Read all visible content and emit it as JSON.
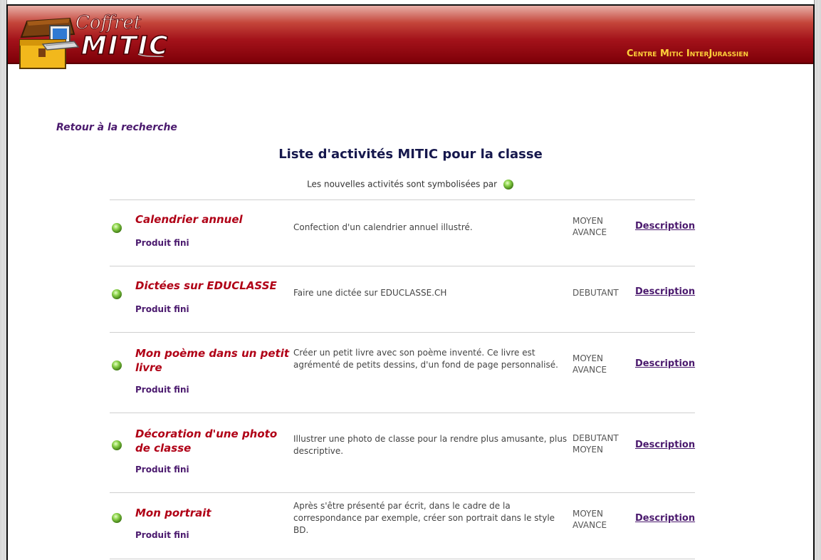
{
  "header": {
    "logo_small": "Coffret",
    "logo_big": "MITIC",
    "center_name": "Centre Mitic InterJurassien"
  },
  "nav": {
    "back_link": "Retour à la recherche"
  },
  "main": {
    "title": "Liste d'activités MITIC pour la classe",
    "legend": "Les nouvelles activités sont symbolisées par",
    "activities": [
      {
        "title": "Calendrier annuel",
        "category": "Produit fini",
        "description": "Confection d'un calendrier annuel illustré.",
        "level": "MOYEN AVANCE",
        "link": "Description",
        "is_new": true
      },
      {
        "title": "Dictées sur EDUCLASSE",
        "category": "Produit fini",
        "description": "Faire une dictée sur EDUCLASSE.CH",
        "level": "DEBUTANT",
        "link": "Description",
        "is_new": true
      },
      {
        "title": "Mon poème dans un petit livre",
        "category": "Produit fini",
        "description": "Créer un petit livre avec son poème inventé. Ce livre est agrémenté de petits dessins, d'un fond de page personnalisé.",
        "level": "MOYEN AVANCE",
        "link": "Description",
        "is_new": true
      },
      {
        "title": "Décoration d'une photo de classe",
        "category": "Produit fini",
        "description": "Illustrer une photo de classe pour la rendre plus amusante, plus descriptive.",
        "level": "DEBUTANT MOYEN",
        "link": "Description",
        "is_new": true
      },
      {
        "title": "Mon portrait",
        "category": "Produit fini",
        "description": "Après s'être présenté par écrit, dans le cadre de la correspondance par exemple, créer son portrait dans le style BD.",
        "level": "MOYEN AVANCE",
        "link": "Description",
        "is_new": true
      }
    ]
  },
  "colors": {
    "header_red": "#a3121a",
    "title_red": "#b00016",
    "link_purple": "#4b1a6e",
    "new_dot_green": "#7cc43a"
  },
  "icons": {
    "new_indicator": "green-dot-icon"
  }
}
